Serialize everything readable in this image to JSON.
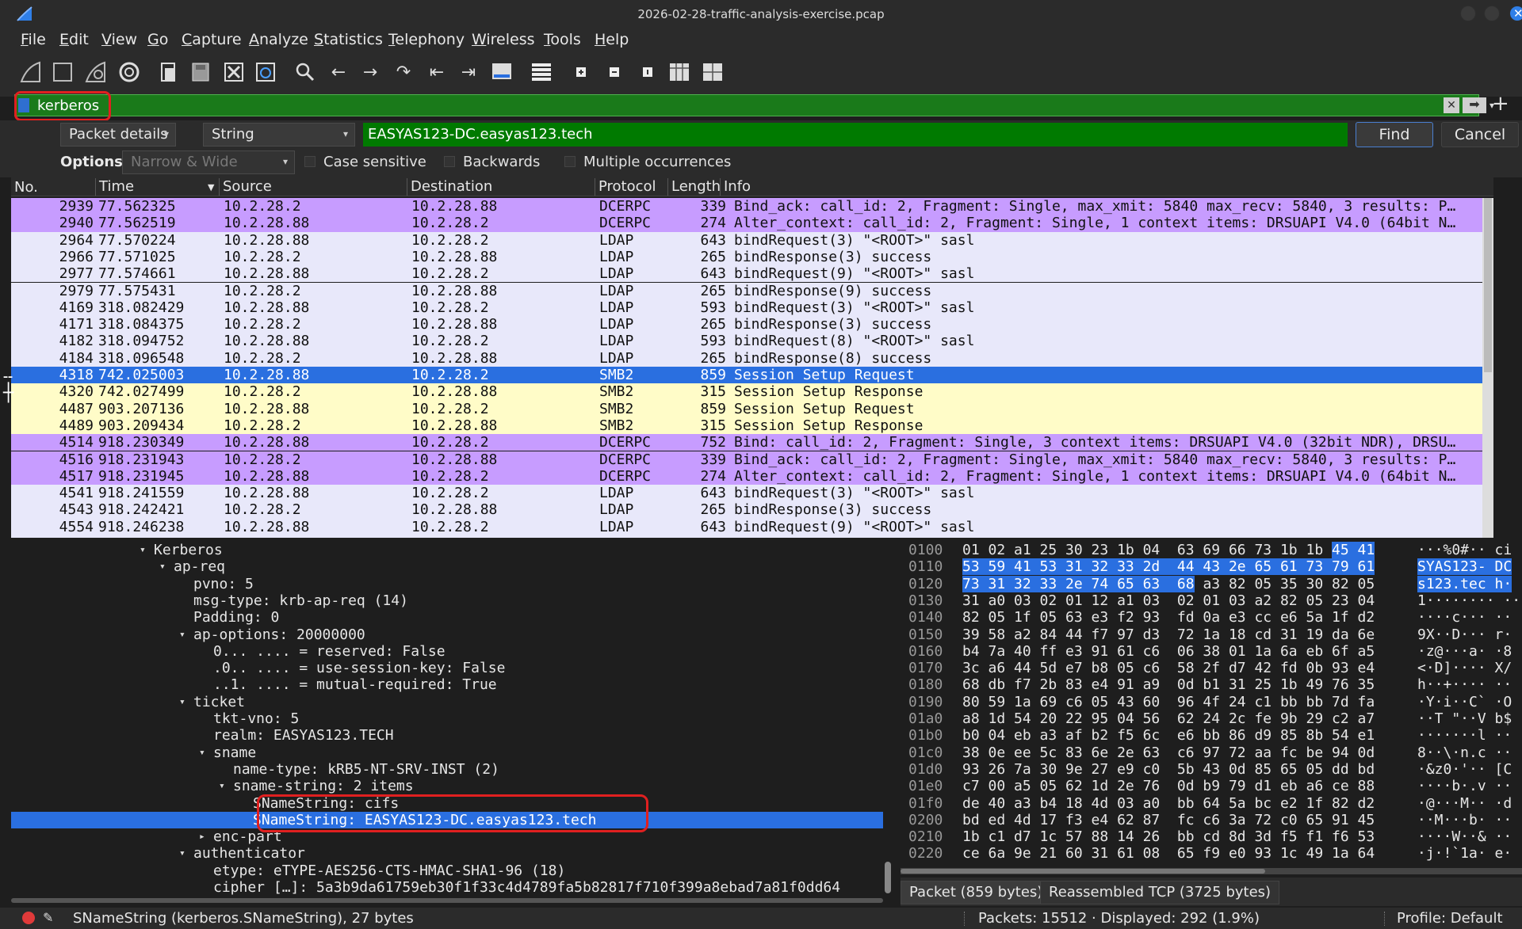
{
  "window": {
    "title": "2026-02-28-traffic-analysis-exercise.pcap"
  },
  "menu": [
    "File",
    "Edit",
    "View",
    "Go",
    "Capture",
    "Analyze",
    "Statistics",
    "Telephony",
    "Wireless",
    "Tools",
    "Help"
  ],
  "toolbar": {
    "icons": [
      "shark-fin-start-icon",
      "stop-square-icon",
      "shark-fin-restart-icon",
      "gear-options-icon",
      "open-file-icon",
      "save-file-icon",
      "close-file-icon",
      "reload-icon",
      "search-icon",
      "arrow-left-icon",
      "arrow-right-icon",
      "jump-icon",
      "first-packet-icon",
      "last-packet-icon",
      "autoscroll-icon",
      "colorize-icon",
      "zoom-in-icon",
      "zoom-out-icon",
      "normal-size-icon",
      "resize-columns-icon",
      "layout-icon"
    ]
  },
  "filter": {
    "value": "kerberos",
    "apply_icon": "arrow-right-icon",
    "clear_icon": "clear-x-icon",
    "add_icon": "+"
  },
  "find": {
    "search_in": "Packet details",
    "search_type": "String",
    "search_value": "EASYAS123-DC.easyas123.tech",
    "find_label": "Find",
    "cancel_label": "Cancel",
    "options_label": "Options:",
    "encoding": "Narrow & Wide",
    "case_sensitive": "Case sensitive",
    "backwards": "Backwards",
    "multiple": "Multiple occurrences"
  },
  "packet_list": {
    "columns": [
      "No.",
      "Time",
      "Source",
      "Destination",
      "Protocol",
      "Length",
      "Info"
    ],
    "rows": [
      {
        "no": "2939",
        "time": "77.562325",
        "src": "10.2.28.2",
        "dst": "10.2.28.88",
        "proto": "DCERPC",
        "len": "339",
        "info": "Bind_ack: call_id: 2, Fragment: Single, max_xmit: 5840 max_recv: 5840, 3 results: P…",
        "color": "#c79cff"
      },
      {
        "no": "2940",
        "time": "77.562519",
        "src": "10.2.28.88",
        "dst": "10.2.28.2",
        "proto": "DCERPC",
        "len": "274",
        "info": "Alter_context: call_id: 2, Fragment: Single, 1 context items: DRSUAPI V4.0 (64bit N…",
        "color": "#c79cff"
      },
      {
        "no": "2964",
        "time": "77.570224",
        "src": "10.2.28.88",
        "dst": "10.2.28.2",
        "proto": "LDAP",
        "len": "643",
        "info": "bindRequest(3) \"<ROOT>\" sasl",
        "color": "#e8e8fa"
      },
      {
        "no": "2966",
        "time": "77.571025",
        "src": "10.2.28.2",
        "dst": "10.2.28.88",
        "proto": "LDAP",
        "len": "265",
        "info": "bindResponse(3) success",
        "color": "#e8e8fa"
      },
      {
        "no": "2977",
        "time": "77.574661",
        "src": "10.2.28.88",
        "dst": "10.2.28.2",
        "proto": "LDAP",
        "len": "643",
        "info": "bindRequest(9) \"<ROOT>\" sasl",
        "color": "#e8e8fa"
      },
      {
        "no": "2979",
        "time": "77.575431",
        "src": "10.2.28.2",
        "dst": "10.2.28.88",
        "proto": "LDAP",
        "len": "265",
        "info": "bindResponse(9) success",
        "color": "#e8e8fa"
      },
      {
        "no": "4169",
        "time": "318.082429",
        "src": "10.2.28.88",
        "dst": "10.2.28.2",
        "proto": "LDAP",
        "len": "593",
        "info": "bindRequest(3) \"<ROOT>\" sasl",
        "color": "#e8e8fa"
      },
      {
        "no": "4171",
        "time": "318.084375",
        "src": "10.2.28.2",
        "dst": "10.2.28.88",
        "proto": "LDAP",
        "len": "265",
        "info": "bindResponse(3) success",
        "color": "#e8e8fa"
      },
      {
        "no": "4182",
        "time": "318.094752",
        "src": "10.2.28.88",
        "dst": "10.2.28.2",
        "proto": "LDAP",
        "len": "593",
        "info": "bindRequest(8) \"<ROOT>\" sasl",
        "color": "#e8e8fa"
      },
      {
        "no": "4184",
        "time": "318.096548",
        "src": "10.2.28.2",
        "dst": "10.2.28.88",
        "proto": "LDAP",
        "len": "265",
        "info": "bindResponse(8) success",
        "color": "#e8e8fa"
      },
      {
        "no": "4318",
        "time": "742.025003",
        "src": "10.2.28.88",
        "dst": "10.2.28.2",
        "proto": "SMB2",
        "len": "859",
        "info": "Session Setup Request",
        "color": "#2a6fe0",
        "selected": true
      },
      {
        "no": "4320",
        "time": "742.027499",
        "src": "10.2.28.2",
        "dst": "10.2.28.88",
        "proto": "SMB2",
        "len": "315",
        "info": "Session Setup Response",
        "color": "#fffcc8"
      },
      {
        "no": "4487",
        "time": "903.207136",
        "src": "10.2.28.88",
        "dst": "10.2.28.2",
        "proto": "SMB2",
        "len": "859",
        "info": "Session Setup Request",
        "color": "#fffcc8"
      },
      {
        "no": "4489",
        "time": "903.209434",
        "src": "10.2.28.2",
        "dst": "10.2.28.88",
        "proto": "SMB2",
        "len": "315",
        "info": "Session Setup Response",
        "color": "#fffcc8"
      },
      {
        "no": "4514",
        "time": "918.230349",
        "src": "10.2.28.88",
        "dst": "10.2.28.2",
        "proto": "DCERPC",
        "len": "752",
        "info": "Bind: call_id: 2, Fragment: Single, 3 context items: DRSUAPI V4.0 (32bit NDR), DRSU…",
        "color": "#c79cff"
      },
      {
        "no": "4516",
        "time": "918.231943",
        "src": "10.2.28.2",
        "dst": "10.2.28.88",
        "proto": "DCERPC",
        "len": "339",
        "info": "Bind_ack: call_id: 2, Fragment: Single, max_xmit: 5840 max_recv: 5840, 3 results: P…",
        "color": "#c79cff"
      },
      {
        "no": "4517",
        "time": "918.231945",
        "src": "10.2.28.88",
        "dst": "10.2.28.2",
        "proto": "DCERPC",
        "len": "274",
        "info": "Alter_context: call_id: 2, Fragment: Single, 1 context items: DRSUAPI V4.0 (64bit N…",
        "color": "#c79cff"
      },
      {
        "no": "4541",
        "time": "918.241559",
        "src": "10.2.28.88",
        "dst": "10.2.28.2",
        "proto": "LDAP",
        "len": "643",
        "info": "bindRequest(3) \"<ROOT>\" sasl",
        "color": "#e8e8fa"
      },
      {
        "no": "4543",
        "time": "918.242421",
        "src": "10.2.28.2",
        "dst": "10.2.28.88",
        "proto": "LDAP",
        "len": "265",
        "info": "bindResponse(3) success",
        "color": "#e8e8fa"
      },
      {
        "no": "4554",
        "time": "918.246238",
        "src": "10.2.28.88",
        "dst": "10.2.28.2",
        "proto": "LDAP",
        "len": "643",
        "info": "bindRequest(9) \"<ROOT>\" sasl",
        "color": "#e8e8fa"
      }
    ]
  },
  "details": [
    {
      "indent": 0,
      "tw": "v",
      "text": "Kerberos"
    },
    {
      "indent": 1,
      "tw": "v",
      "text": "ap-req"
    },
    {
      "indent": 2,
      "tw": "",
      "text": "pvno: 5"
    },
    {
      "indent": 2,
      "tw": "",
      "text": "msg-type: krb-ap-req (14)"
    },
    {
      "indent": 2,
      "tw": "",
      "text": "Padding: 0"
    },
    {
      "indent": 2,
      "tw": "v",
      "text": "ap-options: 20000000"
    },
    {
      "indent": 3,
      "tw": "",
      "text": "0... .... = reserved: False"
    },
    {
      "indent": 3,
      "tw": "",
      "text": ".0.. .... = use-session-key: False"
    },
    {
      "indent": 3,
      "tw": "",
      "text": "..1. .... = mutual-required: True"
    },
    {
      "indent": 2,
      "tw": "v",
      "text": "ticket"
    },
    {
      "indent": 3,
      "tw": "",
      "text": "tkt-vno: 5"
    },
    {
      "indent": 3,
      "tw": "",
      "text": "realm: EASYAS123.TECH"
    },
    {
      "indent": 3,
      "tw": "v",
      "text": "sname"
    },
    {
      "indent": 4,
      "tw": "",
      "text": "name-type: kRB5-NT-SRV-INST (2)"
    },
    {
      "indent": 4,
      "tw": "v",
      "text": "sname-string: 2 items"
    },
    {
      "indent": 5,
      "tw": "",
      "text": "SNameString: cifs"
    },
    {
      "indent": 5,
      "tw": "",
      "text": "SNameString: EASYAS123-DC.easyas123.tech",
      "selected": true
    },
    {
      "indent": 3,
      "tw": ">",
      "text": "enc-part"
    },
    {
      "indent": 2,
      "tw": "v",
      "text": "authenticator"
    },
    {
      "indent": 3,
      "tw": "",
      "text": "etype: eTYPE-AES256-CTS-HMAC-SHA1-96 (18)"
    },
    {
      "indent": 3,
      "tw": "",
      "text": "cipher […]: 5a3b9da61759eb30f1f33c4d4789fa5b82817f710f399a8ebad7a81f0dd64"
    }
  ],
  "hex": [
    {
      "off": "0100",
      "hex": [
        "01 02 a1 25 30 23 1b 04  63 69 66 73 1b 1b ",
        "45 41",
        ""
      ],
      "asc": [
        "···%0#·· ci",
        "",
        ""
      ],
      "hl_hex": [
        false,
        true,
        false
      ],
      "asc_hl": false
    },
    {
      "off": "0110",
      "hex": [
        "",
        "53 59 41 53 31 32 33 2d  44 43 2e 65 61 73 79 61",
        ""
      ],
      "asc": [
        "SYAS123- DC"
      ],
      "full": true
    },
    {
      "off": "0120",
      "hex": [
        "",
        "73 31 32 33 2e 74 65 63  68",
        " a3 82 05 35 30 82 05"
      ],
      "asc": [
        "s123.tec h·"
      ],
      "full": true,
      "partial": true
    },
    {
      "off": "0130",
      "hex": [
        "31 a0 03 02 01 12 a1 03  02 01 03 a2 82 05 23 04"
      ],
      "asc": [
        "1········ ··"
      ]
    },
    {
      "off": "0140",
      "hex": [
        "82 05 1f 05 63 e3 f2 93  fd 0a e3 cc e6 5a 1f d2"
      ],
      "asc": [
        "····c··· ··"
      ]
    },
    {
      "off": "0150",
      "hex": [
        "39 58 a2 84 44 f7 97 d3  72 1a 18 cd 31 19 da 6e"
      ],
      "asc": [
        "9X··D··· r·"
      ]
    },
    {
      "off": "0160",
      "hex": [
        "b4 7a 40 ff e3 91 61 c6  06 38 01 1a 6a eb 6f a5"
      ],
      "asc": [
        "·z@···a· ·8"
      ]
    },
    {
      "off": "0170",
      "hex": [
        "3c a6 44 5d e7 b8 05 c6  58 2f d7 42 fd 0b 93 e4"
      ],
      "asc": [
        "<·D]···· X/"
      ]
    },
    {
      "off": "0180",
      "hex": [
        "68 db f7 2b 83 e4 91 a9  0d b1 31 25 1b 49 76 35"
      ],
      "asc": [
        "h··+···· ··"
      ]
    },
    {
      "off": "0190",
      "hex": [
        "80 59 1a 69 c6 05 43 60  96 4f 24 c1 bb bb 7d fa"
      ],
      "asc": [
        "·Y·i··C` ·O"
      ]
    },
    {
      "off": "01a0",
      "hex": [
        "a8 1d 54 20 22 95 04 56  62 24 2c fe 9b 29 c2 a7"
      ],
      "asc": [
        "··T \"··V b$"
      ]
    },
    {
      "off": "01b0",
      "hex": [
        "b0 04 eb a3 af b2 f5 6c  e6 bb 86 d9 85 8b 54 e1"
      ],
      "asc": [
        "·······l ··"
      ]
    },
    {
      "off": "01c0",
      "hex": [
        "38 0e ee 5c 83 6e 2e 63  c6 97 72 aa fc be 94 0d"
      ],
      "asc": [
        "8··\\·n.c ··"
      ]
    },
    {
      "off": "01d0",
      "hex": [
        "93 26 7a 30 9e 27 e9 c0  5b 43 0d 85 65 05 dd bd"
      ],
      "asc": [
        "·&z0·'·· [C"
      ]
    },
    {
      "off": "01e0",
      "hex": [
        "c7 00 a5 05 62 1d 2e 76  0d b9 79 d1 eb a6 ce 88"
      ],
      "asc": [
        "····b·.v ··"
      ]
    },
    {
      "off": "01f0",
      "hex": [
        "de 40 a3 b4 18 4d 03 a0  bb 64 5a bc e2 1f 82 d2"
      ],
      "asc": [
        "·@···M·· ·d"
      ]
    },
    {
      "off": "0200",
      "hex": [
        "bd ed 4d 17 f3 e4 62 87  fc c6 3a 72 c0 65 91 45"
      ],
      "asc": [
        "··M···b· ··"
      ]
    },
    {
      "off": "0210",
      "hex": [
        "1b c1 d7 1c 57 88 14 26  bb cd 8d 3d f5 f1 f6 53"
      ],
      "asc": [
        "····W··& ··"
      ]
    },
    {
      "off": "0220",
      "hex": [
        "ce 6a 9e 21 60 31 61 08  65 f9 e0 93 1c 49 1a 64"
      ],
      "asc": [
        "·j·!`1a· e·"
      ]
    }
  ],
  "bytes_tabs": [
    "Packet (859 bytes)",
    "Reassembled TCP (3725 bytes)"
  ],
  "status": {
    "field": "SNameString (kerberos.SNameString), 27 bytes",
    "packets": "Packets: 15512 · Displayed: 292 (1.9%)",
    "profile": "Profile: Default"
  },
  "colors": {
    "dcerpc": "#c79cff",
    "ldap": "#e8e8fa",
    "smb2": "#fffcc8",
    "selected": "#2a6fe0",
    "filter_ok": "#1a7a1a",
    "annotation": "#e02020"
  }
}
